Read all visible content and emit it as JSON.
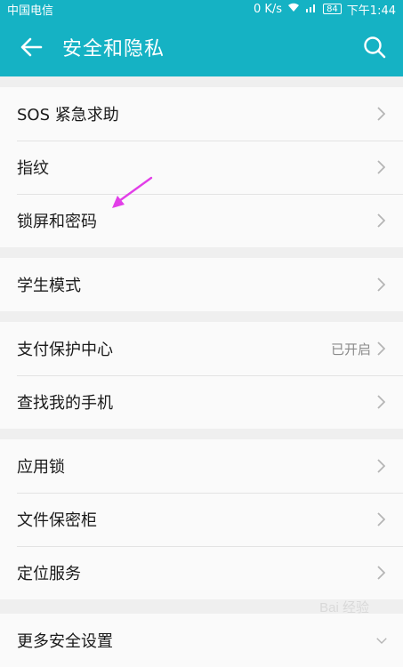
{
  "status_bar": {
    "carrier": "中国电信",
    "speed": "0 K/s",
    "battery": "84",
    "time": "下午1:44"
  },
  "header": {
    "title": "安全和隐私",
    "back_icon": "back-arrow-icon",
    "search_icon": "search-icon"
  },
  "groups": [
    {
      "items": [
        {
          "label": "SOS 紧急求助",
          "value": ""
        },
        {
          "label": "指纹",
          "value": ""
        },
        {
          "label": "锁屏和密码",
          "value": ""
        }
      ]
    },
    {
      "items": [
        {
          "label": "学生模式",
          "value": ""
        }
      ]
    },
    {
      "items": [
        {
          "label": "支付保护中心",
          "value": "已开启"
        },
        {
          "label": "查找我的手机",
          "value": ""
        }
      ]
    },
    {
      "items": [
        {
          "label": "应用锁",
          "value": ""
        },
        {
          "label": "文件保密柜",
          "value": ""
        },
        {
          "label": "定位服务",
          "value": ""
        }
      ]
    }
  ],
  "more": {
    "label": "更多安全设置"
  },
  "watermark": "Bai 经验",
  "colors": {
    "accent": "#15b2c4",
    "annotation_arrow": "#e23ee8"
  }
}
